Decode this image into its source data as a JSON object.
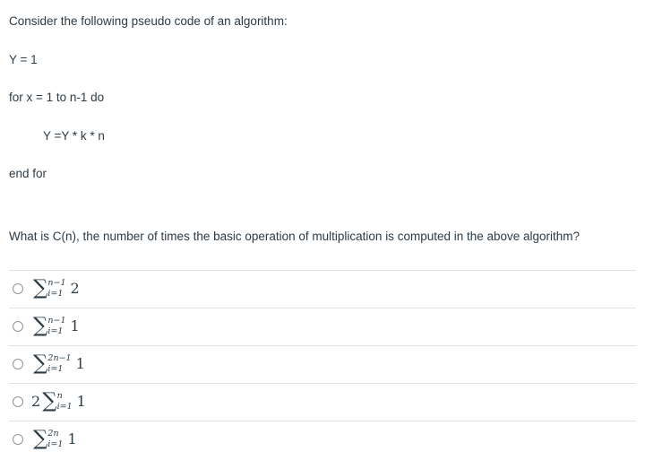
{
  "question": {
    "intro": "Consider the following pseudo code of an algorithm:",
    "pseudocode": [
      {
        "text": "Y = 1",
        "indented": false
      },
      {
        "text": "for x = 1 to n-1 do",
        "indented": false
      },
      {
        "text": "Y =Y * k * n",
        "indented": true
      },
      {
        "text": "end for",
        "indented": false
      }
    ],
    "prompt": "What is C(n), the number of times the basic operation of multiplication is computed in the above algorithm?"
  },
  "answers": [
    {
      "coefficient": "",
      "sum_upper": "n−1",
      "sum_lower": "i=1",
      "summand": "2",
      "selected": false,
      "plain": "∑ from i=1 to n-1 of 2"
    },
    {
      "coefficient": "",
      "sum_upper": "n−1",
      "sum_lower": "i=1",
      "summand": "1",
      "selected": false,
      "plain": "∑ from i=1 to n-1 of 1"
    },
    {
      "coefficient": "",
      "sum_upper": "2n−1",
      "sum_lower": "i=1",
      "summand": "1",
      "selected": false,
      "plain": "∑ from i=1 to 2n-1 of 1"
    },
    {
      "coefficient": "2",
      "sum_upper": "n",
      "sum_lower": "i=1",
      "summand": "1",
      "selected": false,
      "plain": "2 ∑ from i=1 to n of 1"
    },
    {
      "coefficient": "",
      "sum_upper": "2n",
      "sum_lower": "i=1",
      "summand": "1",
      "selected": false,
      "plain": "∑ from i=1 to 2n of 1"
    }
  ],
  "symbols": {
    "sum_glyph": "∑"
  },
  "colors": {
    "text": "#2d3b45",
    "divider": "#e3e3e3",
    "radio_border": "#8b959e",
    "background": "#ffffff"
  }
}
